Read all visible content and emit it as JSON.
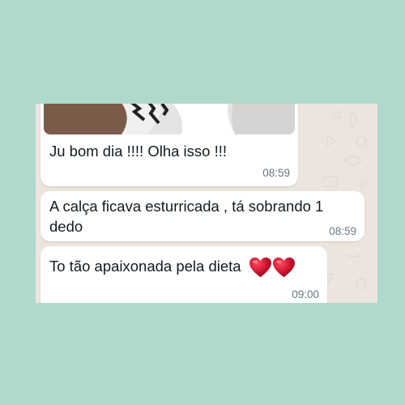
{
  "messages": [
    {
      "text": "Ju bom dia !!!! Olha isso !!!",
      "time": "08:59"
    },
    {
      "text": "A calça ficava esturricada , tá sobrando 1 dedo",
      "time": "08:59"
    },
    {
      "text": "To tão apaixonada pela dieta",
      "time": "09:00",
      "emoji": [
        "red-heart-icon",
        "red-heart-icon"
      ]
    }
  ],
  "colors": {
    "background": "#afd9cb",
    "chat_wallpaper": "#ece5dd",
    "bubble": "#ffffff",
    "text": "#111b21",
    "timestamp": "#667781",
    "heart": "#c8102e"
  }
}
